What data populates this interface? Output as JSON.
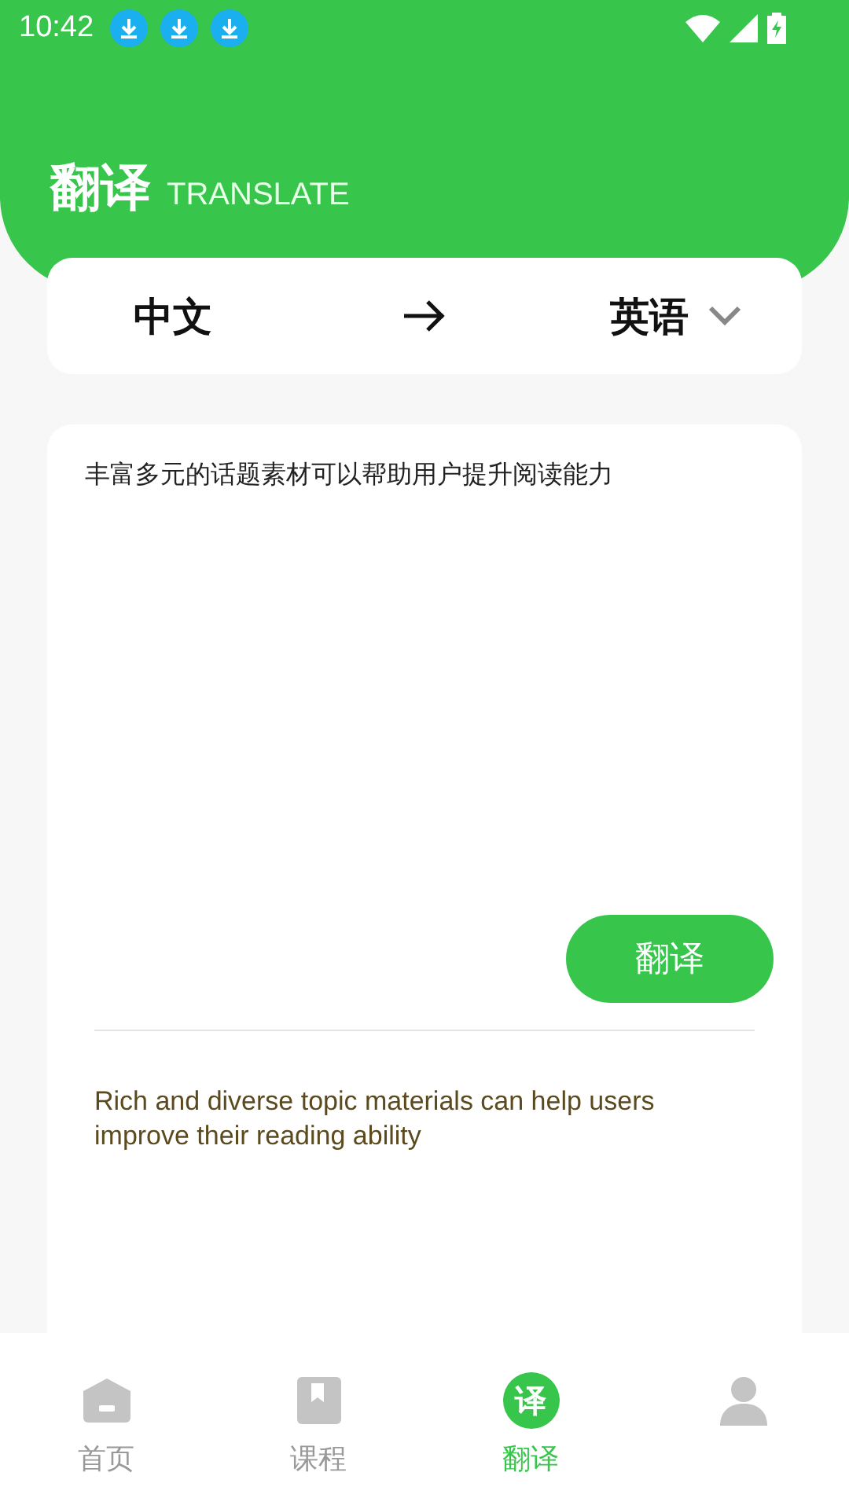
{
  "status_bar": {
    "time": "10:42",
    "notifications": [
      {
        "kind": "download"
      },
      {
        "kind": "download"
      },
      {
        "kind": "download"
      }
    ]
  },
  "header": {
    "title": "翻译",
    "subtitle": "TRANSLATE"
  },
  "language_bar": {
    "source": "中文",
    "target": "英语"
  },
  "input": {
    "value": "丰富多元的话题素材可以帮助用户提升阅读能力"
  },
  "translate_button": "翻译",
  "result": "Rich and diverse topic materials can help users improve their reading ability",
  "tabs": [
    {
      "kind": "home",
      "label": "首页",
      "selected": false
    },
    {
      "kind": "book",
      "label": "课程",
      "selected": false
    },
    {
      "kind": "translate",
      "icon_text": "译",
      "label": "翻译",
      "selected": true
    },
    {
      "kind": "person",
      "selected": false
    }
  ]
}
